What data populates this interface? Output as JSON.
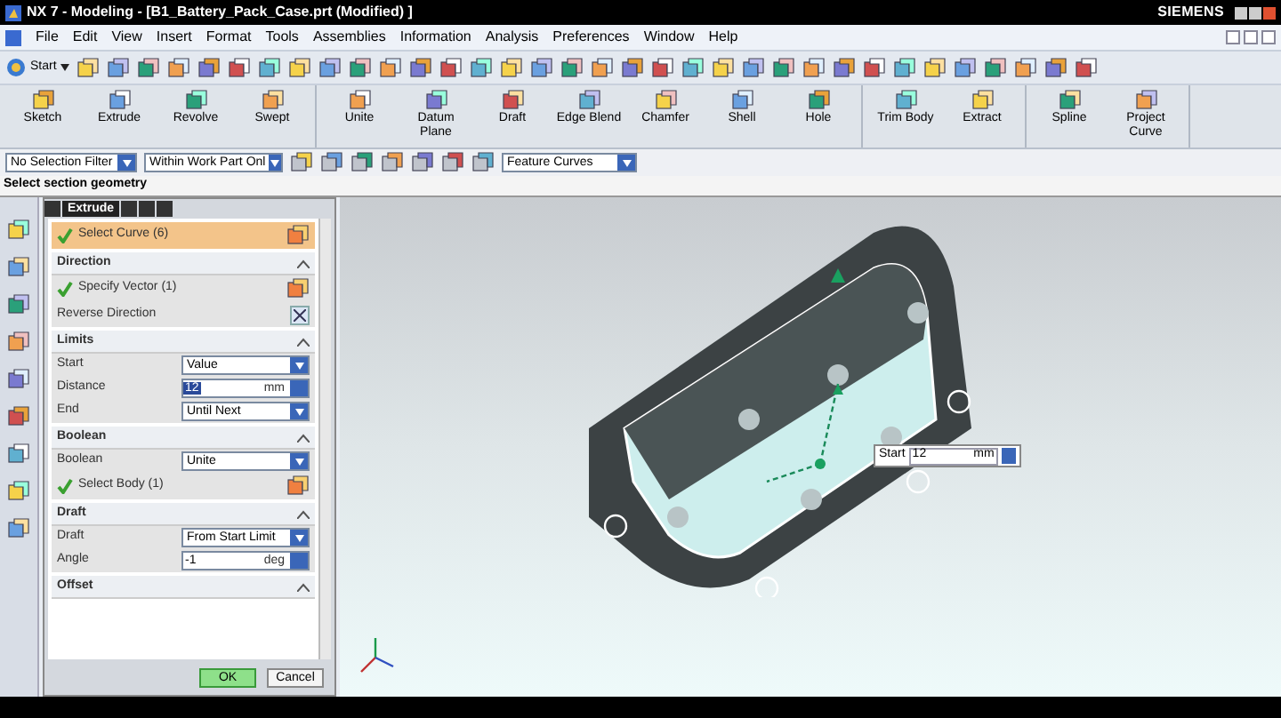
{
  "window": {
    "title": "NX 7 - Modeling - [B1_Battery_Pack_Case.prt (Modified) ]",
    "brand": "SIEMENS"
  },
  "menu": [
    "File",
    "Edit",
    "View",
    "Insert",
    "Format",
    "Tools",
    "Assemblies",
    "Information",
    "Analysis",
    "Preferences",
    "Window",
    "Help"
  ],
  "standard_toolbar": {
    "start": "Start"
  },
  "feature_toolbar": [
    [
      {
        "label": "Sketch"
      },
      {
        "label": "Extrude"
      },
      {
        "label": "Revolve"
      },
      {
        "label": "Swept"
      }
    ],
    [
      {
        "label": "Unite"
      },
      {
        "label": "Datum Plane"
      },
      {
        "label": "Draft"
      },
      {
        "label": "Edge Blend"
      },
      {
        "label": "Chamfer"
      },
      {
        "label": "Shell"
      },
      {
        "label": "Hole"
      }
    ],
    [
      {
        "label": "Trim Body"
      },
      {
        "label": "Extract"
      }
    ],
    [
      {
        "label": "Spline"
      },
      {
        "label": "Project Curve"
      }
    ]
  ],
  "selection_bar": {
    "filter": "No Selection Filter",
    "scope": "Within Work Part Onl",
    "curve_rule": "Feature Curves"
  },
  "status_bar": "Select section geometry",
  "dialog": {
    "title": "Extrude",
    "sections": [
      {
        "rows": [
          {
            "kind": "selection",
            "label": "Select Curve (6)",
            "done": true,
            "selected": true
          }
        ]
      },
      {
        "title": "Direction",
        "rows": [
          {
            "kind": "selection",
            "label": "Specify Vector (1)",
            "done": true,
            "selected": false
          },
          {
            "kind": "action",
            "label": "Reverse Direction"
          }
        ]
      },
      {
        "title": "Limits",
        "rows": [
          {
            "kind": "dropdown",
            "label": "Start",
            "value": "Value"
          },
          {
            "kind": "number",
            "label": "Distance",
            "value": "12",
            "unit": "mm",
            "focused": true
          },
          {
            "kind": "dropdown",
            "label": "End",
            "value": "Until Next"
          }
        ]
      },
      {
        "title": "Boolean",
        "rows": [
          {
            "kind": "dropdown",
            "label": "Boolean",
            "value": "Unite"
          },
          {
            "kind": "selection",
            "label": "Select Body (1)",
            "done": true,
            "selected": false
          }
        ]
      },
      {
        "title": "Draft",
        "rows": [
          {
            "kind": "dropdown",
            "label": "Draft",
            "value": "From Start Limit"
          },
          {
            "kind": "number",
            "label": "Angle",
            "value": "-1",
            "unit": "deg",
            "focused": false
          }
        ]
      },
      {
        "title": "Offset"
      }
    ],
    "buttons": [
      "OK",
      "Cancel"
    ]
  },
  "viewport": {
    "start_label": "Start",
    "start_value": "12",
    "start_unit": "mm"
  }
}
